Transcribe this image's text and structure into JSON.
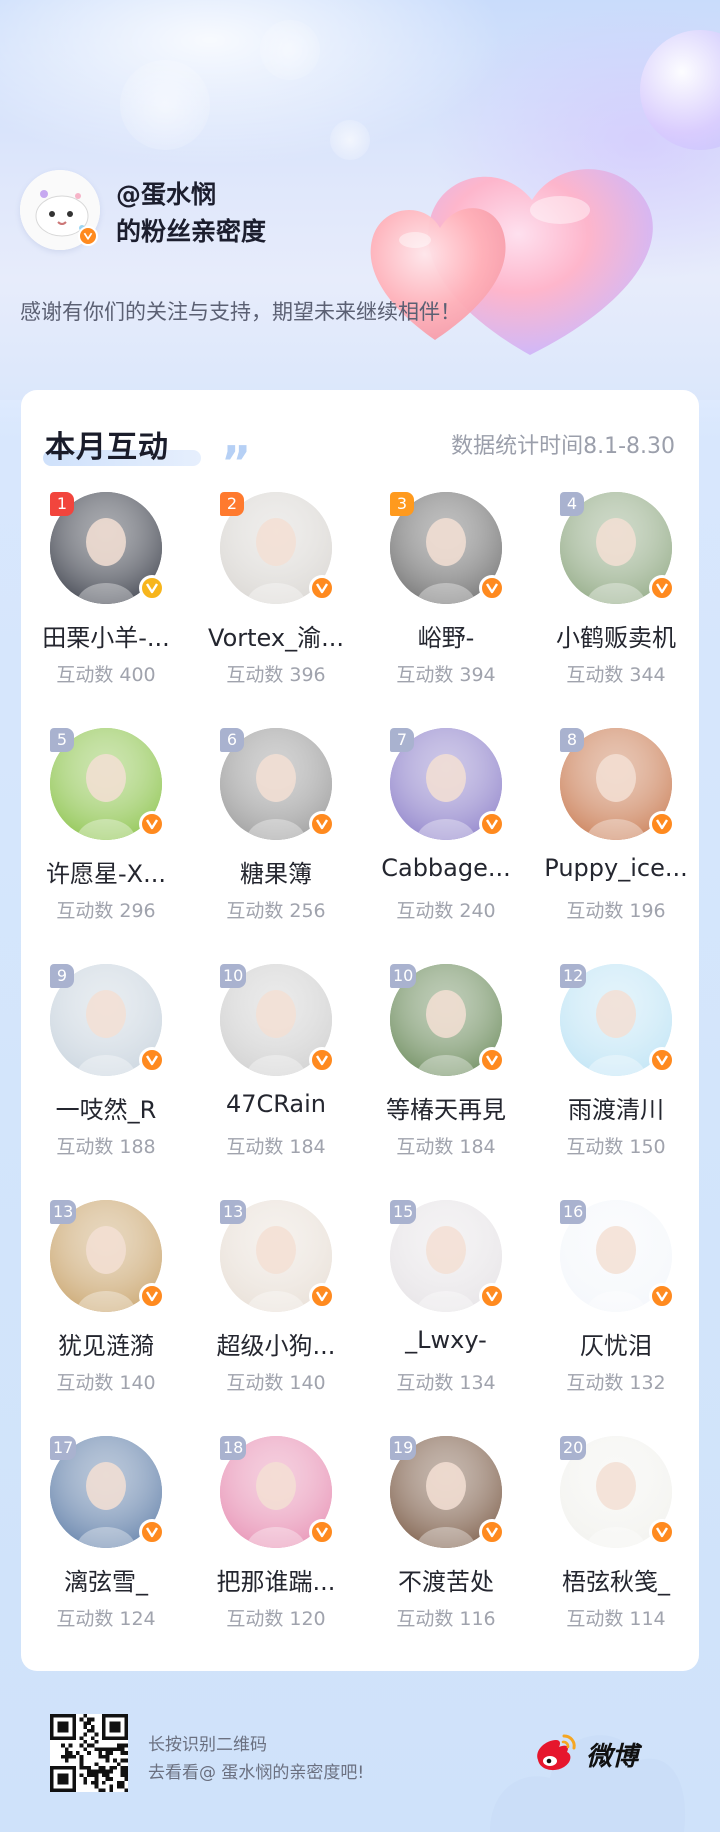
{
  "header": {
    "username": "@蛋水悯",
    "subtitle": "的粉丝亲密度",
    "thanks": "感谢有你们的关注与支持，期望未来继续相伴！"
  },
  "card": {
    "title": "本月互动",
    "date_range": "数据统计时间8.1-8.30"
  },
  "fans": [
    {
      "rank": "1",
      "name": "田栗小羊-...",
      "count": "互动数 400",
      "badge": "gold",
      "tone": "#3b3f4a"
    },
    {
      "rank": "2",
      "name": "Vortex_渝...",
      "count": "互动数 396",
      "badge": "orange",
      "tone": "#d9d6d2"
    },
    {
      "rank": "3",
      "name": "峪野-",
      "count": "互动数 394",
      "badge": "orange",
      "tone": "#6e6e6e"
    },
    {
      "rank": "4",
      "name": "小鹤贩卖机",
      "count": "互动数 344",
      "badge": "orange",
      "tone": "#8fa882"
    },
    {
      "rank": "5",
      "name": "许愿星-X...",
      "count": "互动数 296",
      "badge": "orange",
      "tone": "#8bc34a"
    },
    {
      "rank": "6",
      "name": "糖果簿",
      "count": "互动数 256",
      "badge": "orange",
      "tone": "#9a9a9a"
    },
    {
      "rank": "7",
      "name": "Cabbage...",
      "count": "互动数 240",
      "badge": "orange",
      "tone": "#8c7fc9"
    },
    {
      "rank": "8",
      "name": "Puppy_ice...",
      "count": "互动数 196",
      "badge": "orange",
      "tone": "#c97b52"
    },
    {
      "rank": "9",
      "name": "一吱然_R",
      "count": "互动数 188",
      "badge": "orange",
      "tone": "#c9d4de"
    },
    {
      "rank": "10",
      "name": "47CRain",
      "count": "互动数 184",
      "badge": "orange",
      "tone": "#cfcfcf"
    },
    {
      "rank": "10",
      "name": "等椿天再見",
      "count": "互动数 184",
      "badge": "orange",
      "tone": "#6a8a5a"
    },
    {
      "rank": "12",
      "name": "雨渡清川",
      "count": "互动数 150",
      "badge": "orange",
      "tone": "#bfe4f5"
    },
    {
      "rank": "13",
      "name": "犹见涟漪",
      "count": "互动数 140",
      "badge": "orange",
      "tone": "#c9a46c"
    },
    {
      "rank": "13",
      "name": "超级小狗...",
      "count": "互动数 140",
      "badge": "orange",
      "tone": "#e8dfd6"
    },
    {
      "rank": "15",
      "name": "_Lwxy-",
      "count": "互动数 134",
      "badge": "orange",
      "tone": "#e6e3e6"
    },
    {
      "rank": "16",
      "name": "仄忧泪",
      "count": "互动数 132",
      "badge": "orange",
      "tone": "#f4f7fb"
    },
    {
      "rank": "17",
      "name": "漓弦雪_",
      "count": "互动数 124",
      "badge": "orange",
      "tone": "#5f7ea8"
    },
    {
      "rank": "18",
      "name": "把那谁踹...",
      "count": "互动数 120",
      "badge": "orange",
      "tone": "#e78fb3"
    },
    {
      "rank": "19",
      "name": "不渡苦处",
      "count": "互动数 116",
      "badge": "orange",
      "tone": "#7a5a45"
    },
    {
      "rank": "20",
      "name": "梧弦秋笺_",
      "count": "互动数 114",
      "badge": "orange",
      "tone": "#f2f2ee"
    }
  ],
  "footer": {
    "line1": "长按识别二维码",
    "line2": "去看看@ 蛋水悯的亲密度吧!",
    "brand": "微博"
  },
  "colors": {
    "rank1": "#f2453d",
    "rank2": "#ff7a2e",
    "rank3": "#ff9a1e",
    "rank_default": "#a9b2cf",
    "verified": "#ff8a1f",
    "verified_gold": "#f7b51c"
  }
}
